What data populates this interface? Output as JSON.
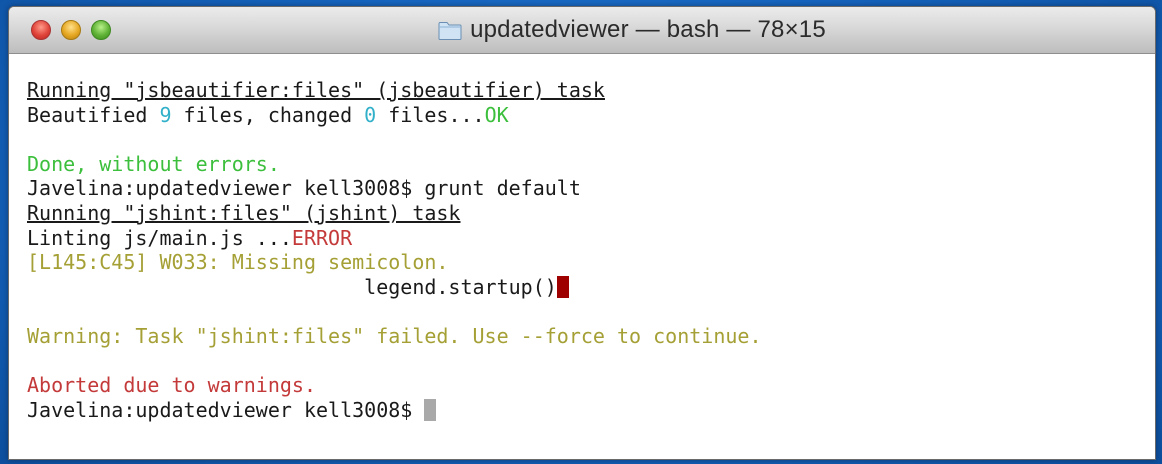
{
  "window": {
    "title": "updatedviewer — bash — 78×15",
    "folder_icon": "folder-icon",
    "traffic_lights": {
      "close": "#e0443a",
      "minimize": "#e6a823",
      "maximize": "#5fb236"
    }
  },
  "colors": {
    "desktop_bg": "#1563bd",
    "cyan": "#31b0c9",
    "green": "#3cbf3c",
    "red": "#c43a3a",
    "yellow": "#a5a035"
  },
  "terminal": {
    "l1": "Running \"jsbeautifier:files\" (jsbeautifier) task",
    "l2_a": "Beautified ",
    "l2_b": "9",
    "l2_c": " files, changed ",
    "l2_d": "0",
    "l2_e": " files...",
    "l2_f": "OK",
    "l4": "Done, without errors.",
    "l5": "Javelina:updatedviewer kell3008$ grunt default",
    "l6": "Running \"jshint:files\" (jshint) task",
    "l7_a": "Linting js/main.js ...",
    "l7_b": "ERROR",
    "l8": "[L145:C45] W033: Missing semicolon.",
    "l9": "                            legend.startup()",
    "l11": "Warning: Task \"jshint:files\" failed. Use --force to continue.",
    "l13": "Aborted due to warnings.",
    "l14": "Javelina:updatedviewer kell3008$ "
  }
}
